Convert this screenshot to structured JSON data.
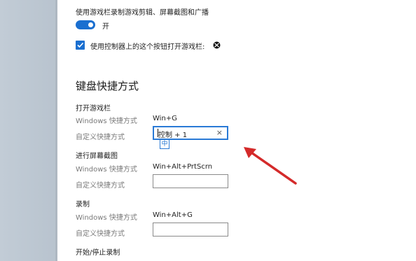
{
  "game_bar": {
    "record_label": "使用游戏栏录制游戏剪辑、屏幕截图和广播",
    "toggle_state_label": "开",
    "controller_label": "使用控制器上的这个按钮打开游戏栏:"
  },
  "shortcuts_heading": "键盘快捷方式",
  "sections": [
    {
      "title": "打开游戏栏",
      "windows_label": "Windows 快捷方式",
      "windows_value": "Win+G",
      "custom_label": "自定义快捷方式",
      "custom_value": "控制 + 1",
      "clear_symbol": "×",
      "ime_indicator": "中"
    },
    {
      "title": "进行屏幕截图",
      "windows_label": "Windows 快捷方式",
      "windows_value": "Win+Alt+PrtScrn",
      "custom_label": "自定义快捷方式",
      "custom_value": ""
    },
    {
      "title": "录制",
      "windows_label": "Windows 快捷方式",
      "windows_value": "Win+Alt+G",
      "custom_label": "自定义快捷方式",
      "custom_value": ""
    },
    {
      "title": "开始/停止录制"
    }
  ],
  "colors": {
    "accent": "#1a6fd0",
    "arrow": "#d42a2a",
    "left_pane": "#c2ccd6"
  }
}
